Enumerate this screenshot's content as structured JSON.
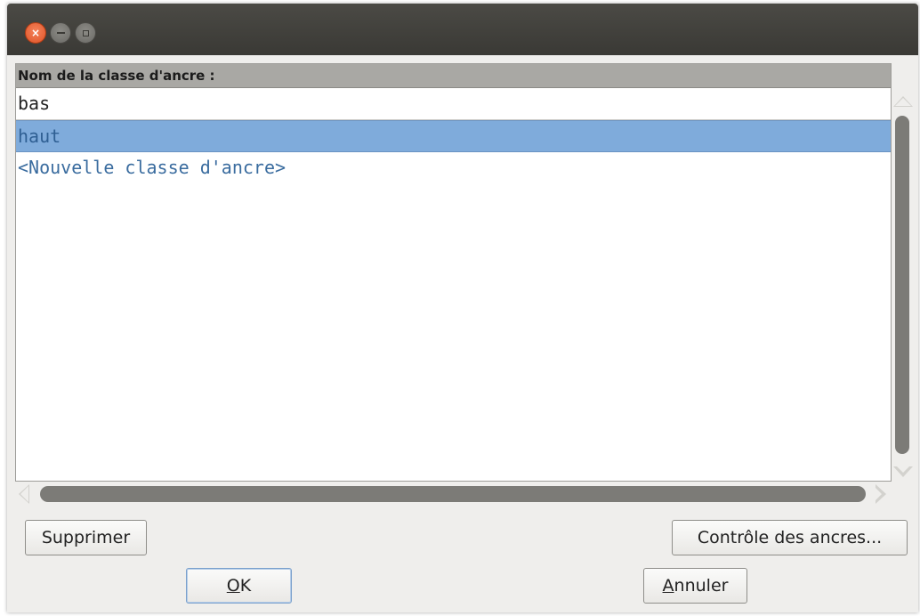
{
  "window": {
    "controls": {
      "close_icon": "close-icon",
      "minimize_icon": "minimize-icon",
      "maximize_icon": "maximize-icon"
    }
  },
  "list": {
    "header": "Nom de la classe d'ancre :",
    "rows": [
      {
        "label": "bas",
        "selected": false
      },
      {
        "label": "haut",
        "selected": true
      },
      {
        "label": "<Nouvelle classe d'ancre>",
        "selected": false
      }
    ]
  },
  "buttons": {
    "delete": "Supprimer",
    "anchor_control": "Contrôle des ancres...",
    "ok_mnemonic": "O",
    "ok_rest": "K",
    "cancel_mnemonic": "A",
    "cancel_rest": "nnuler"
  },
  "colors": {
    "selection_bg": "#7fabdb",
    "titlebar": "#3f3e3a",
    "close_button": "#e05428"
  }
}
